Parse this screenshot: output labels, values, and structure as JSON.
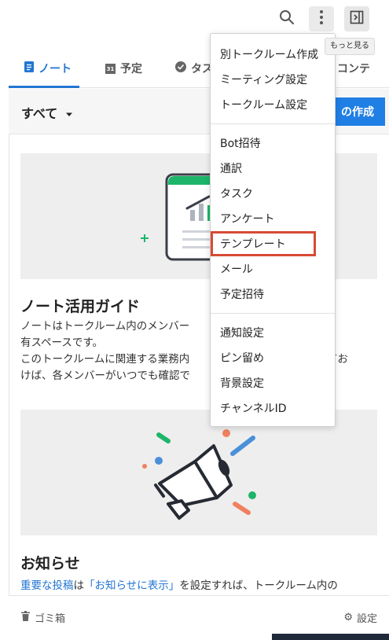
{
  "header": {
    "tooltip": "もっと見る"
  },
  "tabs": [
    {
      "label": "ノート",
      "icon": "note-icon"
    },
    {
      "label": "予定",
      "icon": "calendar-icon"
    },
    {
      "label": "タス",
      "icon": "check-circle-icon"
    },
    {
      "label": "コンテ",
      "icon": ""
    }
  ],
  "filter": {
    "selected": "すべて",
    "create_label": "の作成"
  },
  "sections": [
    {
      "title": "ノート活用ガイド",
      "lines": [
        "ノートはトークルーム内のメンバー　　　　　　　　　　情報共",
        "有スペースです。",
        "このトークルームに関連する業務内　　　　　　　　　　　稿してお",
        "けば、各メンバーがいつでも確認で"
      ]
    },
    {
      "title": "お知らせ",
      "link1": "重要な投稿",
      "mid1": "は",
      "link2": "「お知らせに表示」",
      "rest": "を設定すれば、トークルーム内の"
    }
  ],
  "bottom": {
    "trash": "ゴミ箱",
    "settings": "設定"
  },
  "menu": {
    "group1": [
      "別トークルーム作成",
      "ミーティング設定",
      "トークルーム設定"
    ],
    "group2": [
      "Bot招待",
      "通訳",
      "タスク",
      "アンケート",
      "テンプレート",
      "メール",
      "予定招待"
    ],
    "group3": [
      "通知設定",
      "ピン留め",
      "背景設定",
      "チャンネルID"
    ],
    "highlighted": "テンプレート"
  },
  "colors": {
    "accent": "#2176d2",
    "highlight_border": "#d84a35",
    "illustration_green": "#1db56a"
  },
  "calendar_icon_day": "31"
}
